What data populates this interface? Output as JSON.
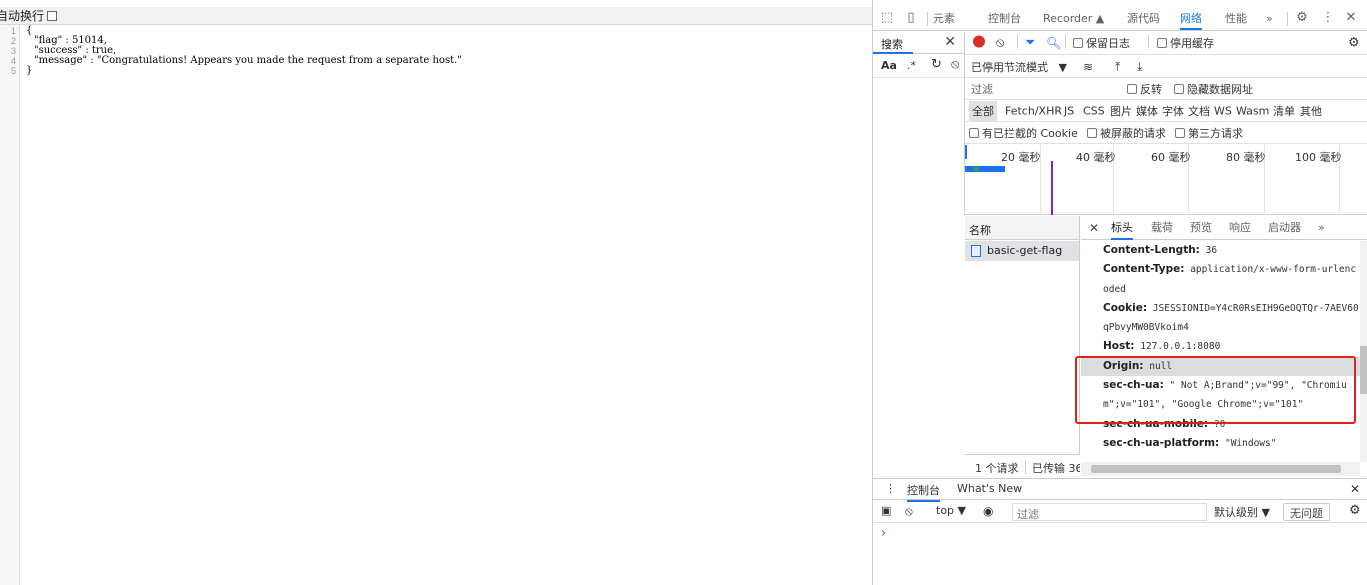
{
  "viewer": {
    "wrap_label": "自动换行",
    "lines": [
      {
        "n": "1",
        "text": "{"
      },
      {
        "n": "2",
        "text": "\"flag\" : 51014,"
      },
      {
        "n": "3",
        "text": "\"success\" : true,"
      },
      {
        "n": "4",
        "text": "\"message\" : \"Congratulations! Appears you made the request from a separate host.\""
      },
      {
        "n": "5",
        "text": "}"
      }
    ]
  },
  "devtools": {
    "tabs": {
      "elements": "元素",
      "console": "控制台",
      "recorder": "Recorder",
      "sources": "源代码",
      "network": "网络",
      "performance": "性能",
      "more": "»"
    },
    "search": {
      "title": "搜索",
      "case": "Aa",
      "regex": ".*"
    },
    "network": {
      "preserve_log": "保留日志",
      "disable_cache": "停用缓存",
      "throttling": "已停用节流模式",
      "filter_placeholder": "过滤",
      "invert": "反转",
      "hide_data_urls": "隐藏数据网址",
      "types": [
        "全部",
        "Fetch/XHR",
        "JS",
        "CSS",
        "图片",
        "媒体",
        "字体",
        "文档",
        "WS",
        "Wasm",
        "清单",
        "其他"
      ],
      "blocked_cookies": "有已拦截的 Cookie",
      "blocked_requests": "被屏蔽的请求",
      "third_party": "第三方请求",
      "timeline_labels": [
        "20 毫秒",
        "40 毫秒",
        "60 毫秒",
        "80 毫秒",
        "100 毫秒"
      ],
      "name_col": "名称",
      "request_name": "basic-get-flag",
      "footer_requests": "1 个请求",
      "footer_transferred": "已传输 36"
    },
    "details": {
      "tabs": [
        "标头",
        "载荷",
        "预览",
        "响应",
        "启动器"
      ],
      "more": "»",
      "headers": [
        {
          "key": "Content-Length:",
          "value": "36"
        },
        {
          "key": "Content-Type:",
          "value": "application/x-www-form-urlencoded"
        },
        {
          "key": "Cookie:",
          "value": "JSESSIONID=Y4cR0RsEIH9GeOQTQr-7AEV60qPbvyMW0BVkoim4"
        },
        {
          "key": "Host:",
          "value": "127.0.0.1:8080"
        },
        {
          "key": "Origin:",
          "value": "null"
        },
        {
          "key": "sec-ch-ua:",
          "value": "\" Not A;Brand\";v=\"99\", \"Chromium\";v=\"101\", \"Google Chrome\";v=\"101\""
        },
        {
          "key": "sec-ch-ua-mobile:",
          "value": "?0"
        },
        {
          "key": "sec-ch-ua-platform:",
          "value": "\"Windows\""
        }
      ]
    },
    "drawer": {
      "console_tab": "控制台",
      "whats_new_tab": "What's New",
      "context": "top ▼",
      "filter_placeholder": "过滤",
      "levels": "默认级别 ▼",
      "issues": "无问题",
      "prompt": "›"
    },
    "colors": {
      "accent": "#1a73e8",
      "record": "#d93025",
      "highlight_box": "#e0201b"
    }
  }
}
